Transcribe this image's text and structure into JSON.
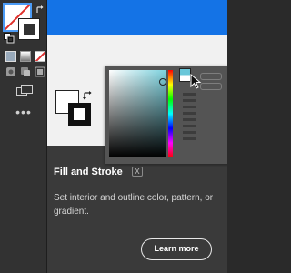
{
  "toolbar": {
    "icons": [
      "fill-stroke-swatch-icon",
      "swap-fill-stroke-icon",
      "default-fill-stroke-icon",
      "color-mode-icon",
      "gradient-mode-icon",
      "none-mode-icon",
      "draw-normal-icon",
      "draw-behind-icon",
      "draw-inside-icon",
      "screen-mode-icon",
      "more-tools-icon"
    ],
    "more_label": "•••"
  },
  "tooltip": {
    "accent_color": "#1473e6",
    "title": "Fill and Stroke",
    "shortcut": "X",
    "description": "Set interior and outline color, pattern, or gradient.",
    "learn_more_label": "Learn more"
  }
}
